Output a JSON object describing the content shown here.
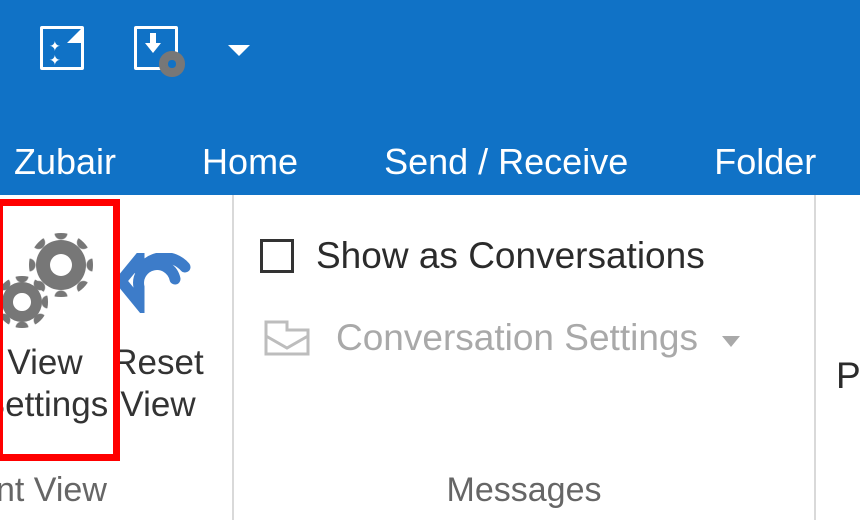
{
  "tabs": {
    "custom": "Zubair",
    "home": "Home",
    "send_receive": "Send / Receive",
    "folder": "Folder"
  },
  "ribbon": {
    "current_view": {
      "view_settings_line1": "View",
      "view_settings_line2": "Settings",
      "reset_line1": "Reset",
      "reset_line2": "View",
      "group_label_partial": "nt View"
    },
    "messages": {
      "show_as_conversations": "Show as Conversations",
      "conversation_settings": "Conversation Settings",
      "group_label": "Messages"
    },
    "right_partial_letter": "P"
  },
  "colors": {
    "accent": "#1072c6",
    "highlight": "#ff0000"
  }
}
